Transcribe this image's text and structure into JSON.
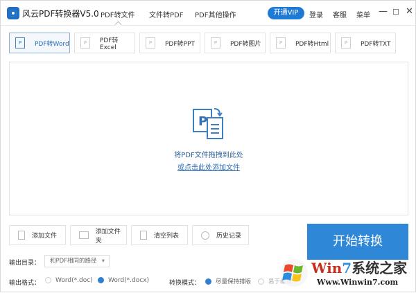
{
  "app": {
    "title": "风云PDF转换器V5.0"
  },
  "nav": {
    "tabs": [
      "PDF转文件",
      "文件转PDF",
      "PDF其他操作"
    ],
    "active": 0
  },
  "header": {
    "vip": "开通VIP",
    "login": "登录",
    "service": "客服",
    "menu": "菜单"
  },
  "window": {
    "minimize": "—",
    "maximize": "☐",
    "close": "✕"
  },
  "formats": [
    {
      "label": "PDF转Word"
    },
    {
      "label": "PDF转Excel"
    },
    {
      "label": "PDF转PPT"
    },
    {
      "label": "PDF转图片"
    },
    {
      "label": "PDF转Html"
    },
    {
      "label": "PDF转TXT"
    }
  ],
  "drop": {
    "hint": "将PDF文件拖拽到此处",
    "link": "或点击此处添加文件"
  },
  "actions": {
    "add_file": "添加文件",
    "add_folder": "添加文件夹",
    "clear": "清空列表",
    "history": "历史记录"
  },
  "start": "开始转换",
  "output": {
    "dir_label": "输出目录：",
    "dir_value": "和PDF相同的路径",
    "format_label": "输出格式：",
    "format_options": [
      "Word(*.doc)",
      "Word(*.docx)"
    ],
    "format_selected": 1,
    "mode_label": "转换模式：",
    "mode_options": [
      "尽量保持排版",
      "易于编辑"
    ],
    "mode_selected": 0
  },
  "watermark": {
    "brand": "Win7系统之家",
    "url": "Www.Winwin7.com"
  },
  "colors": {
    "accent": "#2f87d8"
  }
}
